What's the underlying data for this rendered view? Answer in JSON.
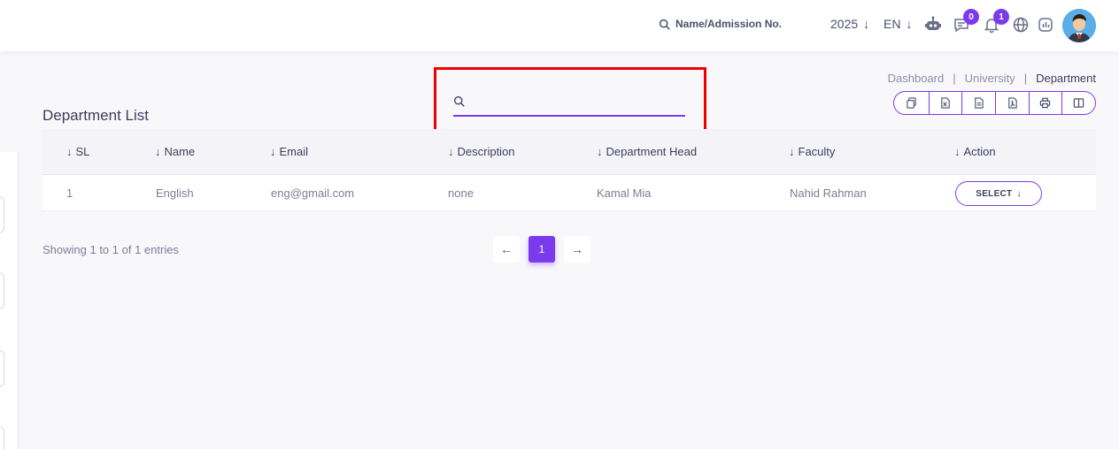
{
  "header": {
    "search_label": "Name/Admission No.",
    "year": "2025",
    "language": "EN",
    "messages_count": "0",
    "notifications_count": "1"
  },
  "breadcrumb": {
    "items": [
      "Dashboard",
      "University",
      "Department"
    ],
    "separator": "|"
  },
  "page": {
    "title": "Department List"
  },
  "search": {
    "value": "",
    "placeholder": ""
  },
  "table": {
    "columns": [
      "SL",
      "Name",
      "Email",
      "Description",
      "Department Head",
      "Faculty",
      "Action"
    ],
    "rows": [
      {
        "sl": "1",
        "name": "English",
        "email": "eng@gmail.com",
        "description": "none",
        "head": "Kamal Mia",
        "faculty": "Nahid Rahman",
        "action": "SELECT"
      }
    ]
  },
  "footer": {
    "info": "Showing 1 to 1 of 1 entries",
    "current_page": "1"
  },
  "colors": {
    "accent": "#7c3aed",
    "highlight": "#ee0000"
  },
  "icons": {
    "header": [
      "search-icon",
      "chatbot-icon",
      "message-icon",
      "bell-icon",
      "globe-icon",
      "chart-icon"
    ],
    "exports": [
      "copy-icon",
      "excel-icon",
      "csv-icon",
      "pdf-icon",
      "print-icon",
      "columns-icon"
    ]
  }
}
